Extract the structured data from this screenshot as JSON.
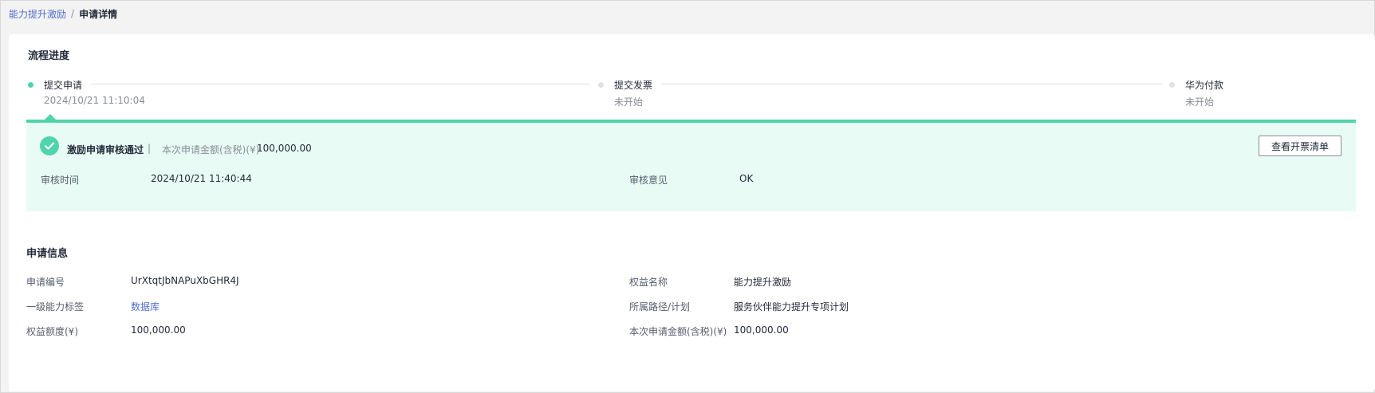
{
  "breadcrumb": {
    "parent": "能力提升激励",
    "separator": "/",
    "current": "申请详情"
  },
  "progress": {
    "title": "流程进度",
    "steps": [
      {
        "label": "提交申请",
        "sub": "2024/10/21 11:10:04",
        "state": "done"
      },
      {
        "label": "提交发票",
        "sub": "未开始",
        "state": "pending"
      },
      {
        "label": "华为付款",
        "sub": "未开始",
        "state": "pending"
      }
    ],
    "result": {
      "title": "激励申请审核通过",
      "separator": "|",
      "amount_label": "本次申请金额(含税)(¥)",
      "amount_value": "100,000.00",
      "button_label": "查看开票清单",
      "review_time_label": "审核时间",
      "review_time_value": "2024/10/21 11:40:44",
      "review_opinion_label": "审核意见",
      "review_opinion_value": "OK"
    }
  },
  "info": {
    "title": "申请信息",
    "fields": [
      {
        "label": "申请编号",
        "value": "UrXtqtJbNAPuXbGHR4J"
      },
      {
        "label": "权益名称",
        "value": "能力提升激励"
      },
      {
        "label": "一级能力标签",
        "value": "数据库"
      },
      {
        "label": "所属路径/计划",
        "value": "服务伙伴能力提升专项计划"
      },
      {
        "label": "权益额度(¥)",
        "value": "100,000.00"
      },
      {
        "label": "本次申请金额(含税)(¥)",
        "value": "100,000.00"
      }
    ]
  },
  "colors": {
    "accent": "#50d4ab",
    "link": "#526ecc",
    "panel_bg": "#e8fbf4"
  }
}
